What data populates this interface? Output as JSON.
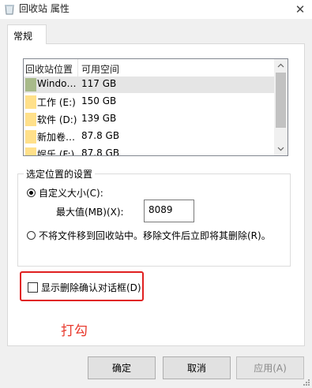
{
  "window": {
    "title": "回收站 属性",
    "close_glyph": "✕"
  },
  "tabs": [
    {
      "label": "常规"
    }
  ],
  "list": {
    "columns": [
      "回收站位置",
      "可用空间"
    ],
    "rows": [
      {
        "name": "Windo…",
        "space": "117 GB",
        "icon": "drive-icon",
        "selected": true
      },
      {
        "name": "工作 (E:)",
        "space": "150 GB",
        "icon": "folder-icon"
      },
      {
        "name": "软件 (D:)",
        "space": "139 GB",
        "icon": "folder-icon"
      },
      {
        "name": "新加卷…",
        "space": "87.8 GB",
        "icon": "folder-icon"
      },
      {
        "name": "娱乐 (F:)",
        "space": "87.8 GB",
        "icon": "folder-icon"
      }
    ]
  },
  "settings": {
    "group_title": "选定位置的设置",
    "custom_size_label": "自定义大小(C):",
    "max_label": "最大值(MB)(X):",
    "max_value": "8089",
    "no_move_label": "不将文件移到回收站中。移除文件后立即将其删除(R)。",
    "custom_size_selected": true
  },
  "confirm_checkbox": {
    "label": "显示删除确认对话框(D)",
    "checked": false
  },
  "annotation": {
    "text": "打勾",
    "color": "#e83a2e"
  },
  "buttons": {
    "ok": "确定",
    "cancel": "取消",
    "apply": "应用(A)"
  },
  "colors": {
    "highlight": "#e02020",
    "selected_row": "#e5e5e5"
  }
}
